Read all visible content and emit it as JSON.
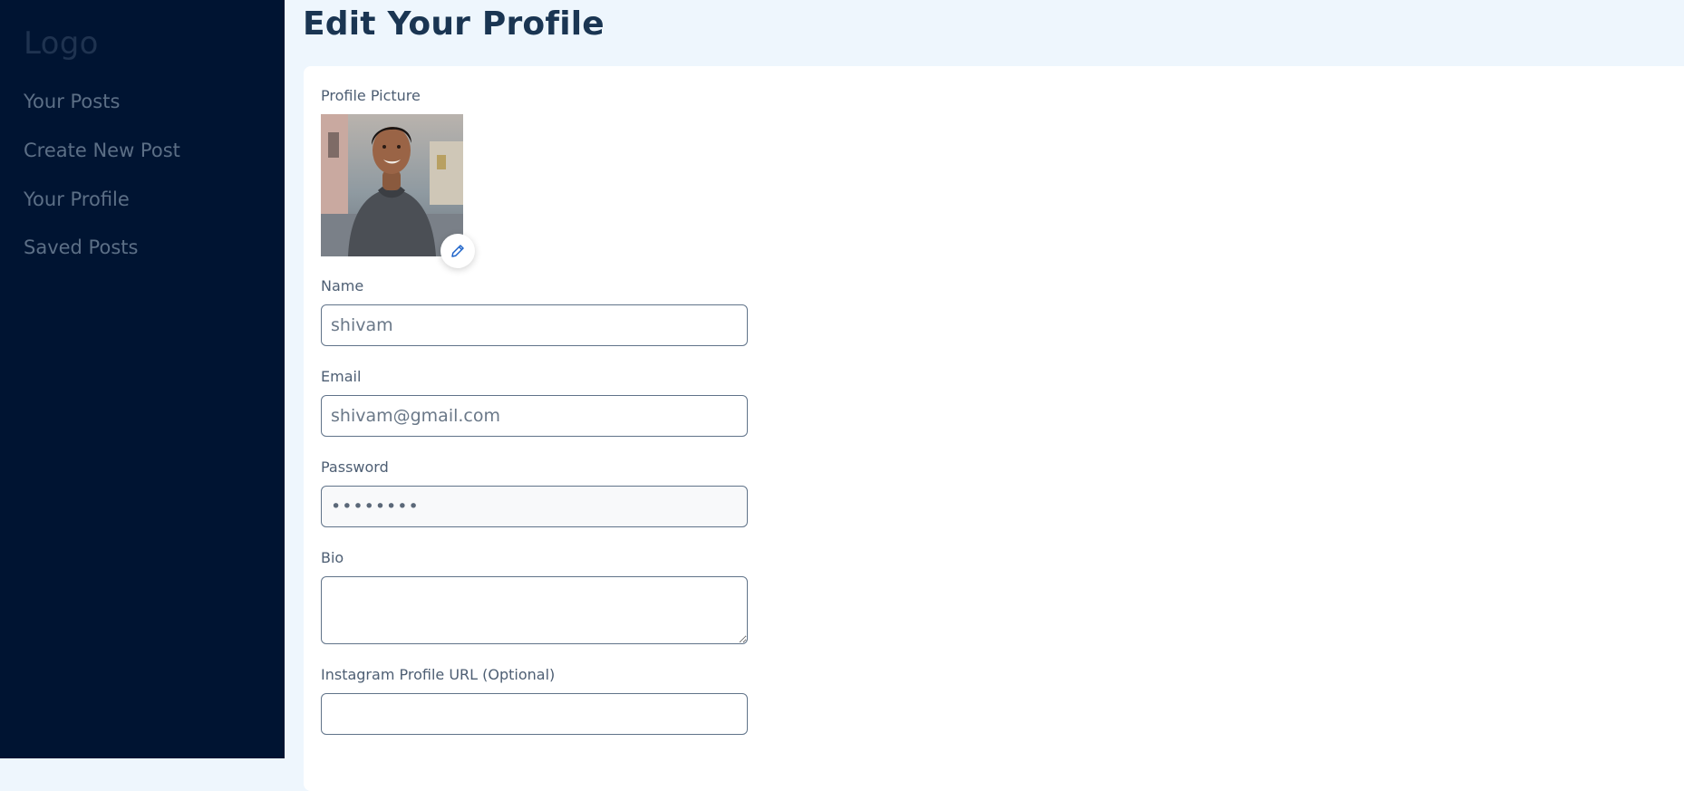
{
  "sidebar": {
    "logo": "Logo",
    "items": [
      {
        "label": "Your Posts"
      },
      {
        "label": "Create New Post"
      },
      {
        "label": "Your Profile"
      },
      {
        "label": "Saved Posts"
      }
    ]
  },
  "page": {
    "title": "Edit Your Profile"
  },
  "form": {
    "profile_picture_label": "Profile Picture",
    "name_label": "Name",
    "name_value": "shivam",
    "email_label": "Email",
    "email_value": "shivam@gmail.com",
    "password_label": "Password",
    "password_value": "••••••••",
    "bio_label": "Bio",
    "bio_value": "",
    "instagram_label": "Instagram Profile URL (Optional)",
    "instagram_value": ""
  },
  "colors": {
    "sidebar_bg": "#001432",
    "page_bg": "#eef6fd",
    "title": "#1a3552",
    "accent": "#1d63c9"
  },
  "icons": {
    "edit_photo": "pencil-icon"
  }
}
